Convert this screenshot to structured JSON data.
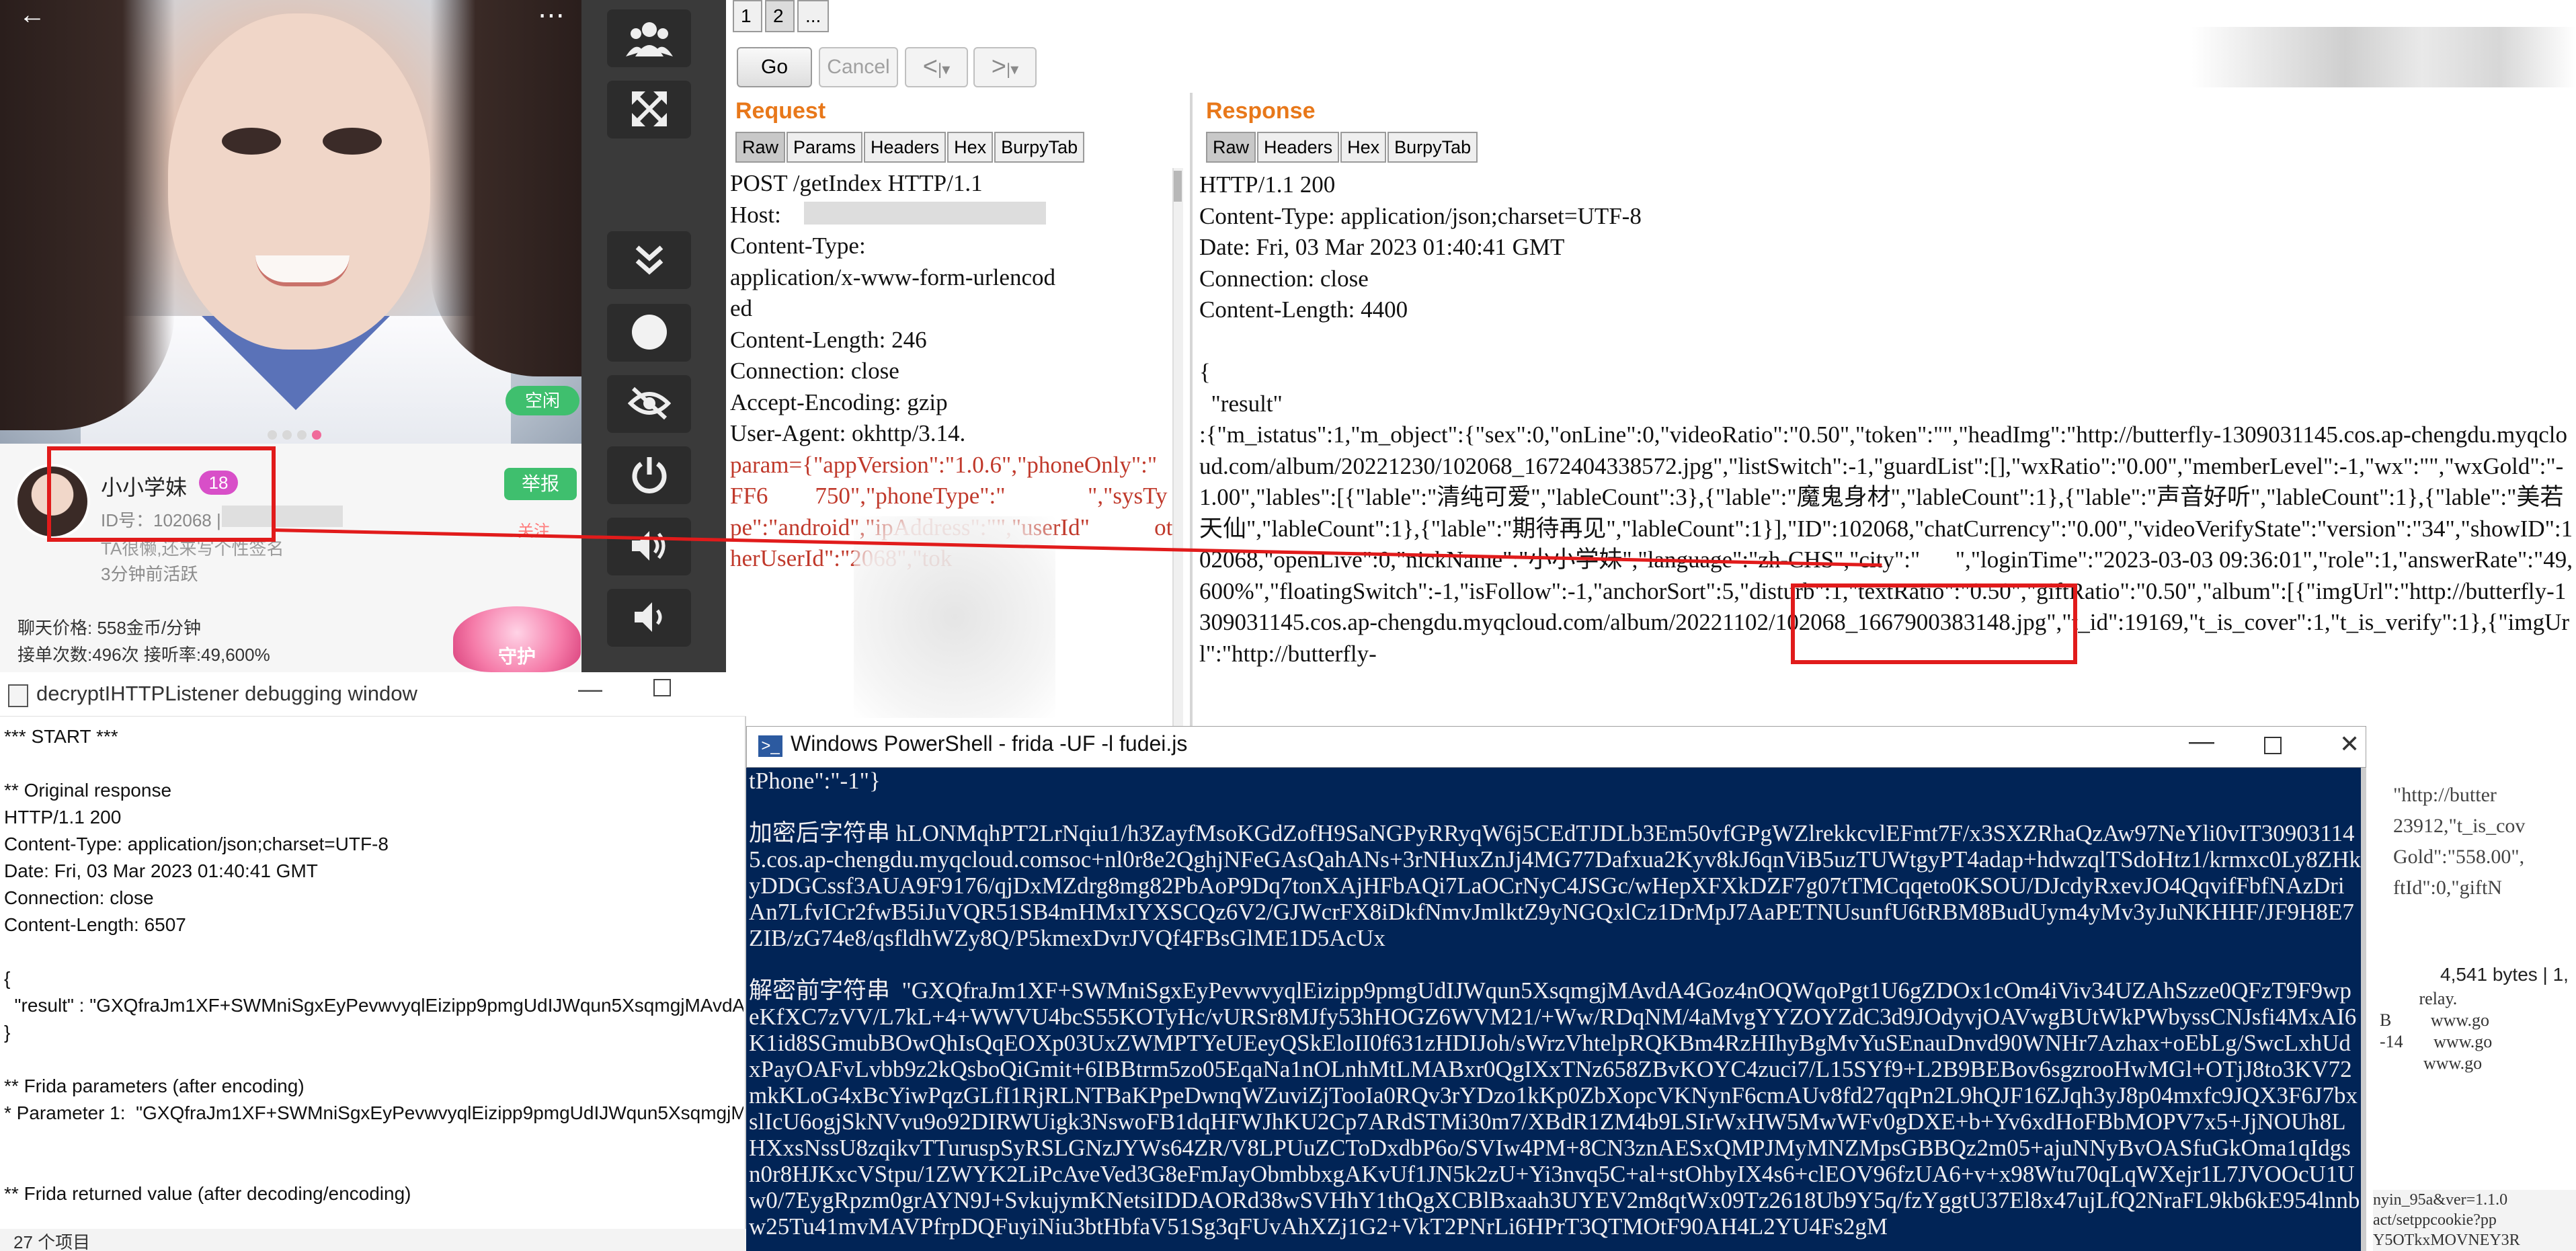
{
  "app_phone": {
    "idle_badge": "空闲",
    "nickname": "小小学妹",
    "age": "18",
    "report_btn": "举报",
    "follow_btn": "关注",
    "id_label": "ID号：102068 |",
    "intro": "TA很懒,还来写个性签名",
    "online_time": "3分钟前活跃",
    "price": "聊天价格: 558金币/分钟",
    "stats": "接单次数:496次 接听率:49,600%",
    "guard": "守护",
    "carousel": {
      "count": 4,
      "active": 4
    }
  },
  "controls": {
    "icons": [
      "group-icon",
      "fullscreen-icon",
      "chevron-down-double-icon",
      "record-icon",
      "eye-hidden-icon",
      "power-icon",
      "volume-up-icon",
      "volume-down-icon"
    ]
  },
  "burp": {
    "tabs": [
      "1",
      "2",
      "..."
    ],
    "go": "Go",
    "cancel": "Cancel",
    "request_title": "Request",
    "response_title": "Response",
    "req_tabs": [
      "Raw",
      "Params",
      "Headers",
      "Hex",
      "BurpyTab"
    ],
    "resp_tabs": [
      "Raw",
      "Headers",
      "Hex",
      "BurpyTab"
    ],
    "request_lines": [
      "POST /getIndex HTTP/1.1",
      "Host:",
      "Content-Type:",
      "application/x-www-form-urlencod",
      "ed",
      "Content-Length: 246",
      "Connection: close",
      "Accept-Encoding: gzip",
      "User-Agent: okhttp/3.14.",
      ""
    ],
    "request_param_prefix": "param=",
    "request_param_text": "{\"appVersion\":\"1.0.6\",\"phoneOnly\":\"                  FF6        750\",\"phoneType\":\"              \",\"sysType\":\"android\",\"ipAddress\":\"\",\"userId\"           otherUserId\":\"2068\",\"tok",
    "response_text": "HTTP/1.1 200\nContent-Type: application/json;charset=UTF-8\nDate: Fri, 03 Mar 2023 01:40:41 GMT\nConnection: close\nContent-Length: 4400\n\n{\n  \"result\"\n:{\"m_istatus\":1,\"m_object\":{\"sex\":0,\"onLine\":0,\"videoRatio\":\"0.50\",\"token\":\"\",\"headImg\":\"http://butterfly-1309031145.cos.ap-chengdu.myqcloud.com/album/20221230/102068_1672404338572.jpg\",\"listSwitch\":-1,\"guardList\":[],\"wxRatio\":\"0.00\",\"memberLevel\":-1,\"wx\":\"\",\"wxGold\":\"-1.00\",\"lables\":[{\"lable\":\"清纯可爱\",\"lableCount\":3},{\"lable\":\"魔鬼身材\",\"lableCount\":1},{\"lable\":\"声音好听\",\"lableCount\":1},{\"lable\":\"美若天仙\",\"lableCount\":1},{\"lable\":\"期待再见\",\"lableCount\":1}],\"ID\":102068,\"chatCurrency\":\"0.00\",\"videoVerifyState\":\"version\":\"34\",\"showID\":102068,\"openLive\":0,\"nickName\":\"小小学妹\",\"language\":\"zh-CHS\",\"city\":\"      \",\"loginTime\":\"2023-03-03 09:36:01\",\"role\":1,\"answerRate\":\"49,600%\",\"floatingSwitch\":-1,\"isFollow\":-1,\"anchorSort\":5,\"disturb\":1,\"textRatio\":\"0.50\",\"giftRatio\":\"0.50\",\"album\":[{\"imgUrl\":\"http://butterfly-1309031145.cos.ap-chengdu.myqcloud.com/album/20221102/102068_1667900383148.jpg\",\"t_id\":19169,\"t_is_cover\":1,\"t_is_verify\":1},{\"imgUrl\":\"http://butterfly-"
  },
  "debug_window": {
    "title": "decryptIHTTPListener debugging window",
    "lines": [
      "*** START ***",
      "",
      "** Original response",
      "HTTP/1.1 200",
      "Content-Type: application/json;charset=UTF-8",
      "Date: Fri, 03 Mar 2023 01:40:41 GMT",
      "Connection: close",
      "Content-Length: 6507",
      "",
      "{",
      "  \"result\" : \"GXQfraJm1XF+SWMniSgxEyPevwvyqlEizipp9pmgUdIJWqun5XsqmgjMAvdA",
      "}",
      "",
      "** Frida parameters (after encoding)",
      "* Parameter 1:  \"GXQfraJm1XF+SWMniSgxEyPevwvyqlEizipp9pmgUdIJWqun5XsqmgjMAvdA",
      "",
      "",
      "** Frida returned value (after decoding/encoding)"
    ],
    "status": "27 个项目"
  },
  "powershell": {
    "title": "Windows PowerShell - frida  -UF -l fudei.js",
    "text": "tPhone\":\"-1\"}\n\n加密后字符串 hLONMqhPT2LrNqiu1/h3ZayfMsoKGdZofH9SaNGPyRRyqW6j5CEdTJDLb3Em50vfGPgWZlrekkcvlEFmt7F/x3SXZRhaQzAw97NeYli0vIT309031145.cos.ap-chengdu.myqcloud.comsoc+nl0r8e2QghjNFeGAsQahANs+3rNHuxZnJj4MG77Dafxua2Kyv8kJ6qnViB5uzTUWtgyPT4adap+hdwzqlTSdoHtz1/krmxc0Ly8ZHkyDDGCssf3AUA9F9176/qjDxMZdrg8mg82PbAoP9Dq7tonXAjHFbAQi7LaOCrNyC4JSGc/wHepXFXkDZF7g07tTMCqqeto0KSOU/DJcdyRxevJO4QqvifFbfNAzDriAn7LfvICr2fwB5iJuVQR51SB4mHMxIYXSCQz6V2/GJWcrFX8iDkfNmvJmlktZ9yNGQxlCz1DrMpJ7AaPETNUsunfU6tRBM8BudUym4yMv3yJuNKHHF/JF9H8E7ZIB/zG74e8/qsfldhWZy8Q/P5kmexDvrJVQf4FBsGlME1D5AcUx\n\n解密前字符串  \"GXQfraJm1XF+SWMniSgxEyPevwvyqlEizipp9pmgUdIJWqun5XsqmgjMAvdA4Goz4nOQWqoPgt1U6gZDOx1cOm4iViv34UZAhSzze0QFzT9F9wpeKfXC7zVV/L7kL+4+WWVU4bcS55KOTyHc/vURSr8MJfy53hHOGZ6WVM21/+Ww/RDqNM/4aMvgYYZOYZdC3d9JOdyvjOAVwgBUtWkPWbyssCNJsfi4MxAI6K1id8SGmubBOwQhIsQqEOXp03UxZWMPTYeUEeyQSkEloII0f631zHDIJoh/sWrzVhtelpRQKBm4RzHIhyBgMvYuSEnauDnvd90WNHr7Azhax+oEbLg/SwcLxhUdxPayOAFvLvbb9z2kQsboQiGmit+6IBBtrm5zo05EqaNa1nOLnhMtLMABxr0QgIXxTNz658ZBvKOYC4zuci7/L15SYf9+L2B9BEBov6sgzrooHwMGl+OTjJ8to3KV72mkKLoG4xBcYiwPqzGLfI1RjRLNTBaKPpeDwnqWZuviZjTooIa0RQv3rYDzo1kKp0ZbXopcVKNynF6cmAUv8fd27qqPn2L9hQJF16ZJqh3yJ8p04mxfc9JQX3F6J7bxslIcU6ogjSkNVvu9o92DIRWUigk3NswoFB1dqHFWJhKU2Cp7ARdSTMi30m7/XBdR1ZM4b9LSIrWxHW5MwWFv0gDXE+b+Yv6xdHoFBbMOPV7x5+JjNOUh8LHXxsNssU8zqikvTTuruspSyRSLGNzJYWs64ZR/V8LPUuZCToDxdbP6o/SVIw4PM+8CN3znAESxQMPJMyMNZMpsGBBQz2m05+ajuNNyBvOASfuGkOma1qIdgsn0r8HJKxcVStpu/1ZWYK2LiPcAveVed3G8eFmJayObmbbxgAKvUf1JN5k2zU+Yi3nvq5C+al+stOhbyIX4s6+clEOV96fzUA6+v+x98Wtu70qLqWXejr1L7JVOOcU1Uw0/7EygRpzm0grAYN9J+SvkujymKNetsiIDDAORd38wSVHhY1thQgXCBlBxaah3UYEV2m8qtWx09Tz2618Ub9Y5q/fzYggtU37El8x47ujLfQ2NraFL9kb6kE954lnnbw25Tu41mvMAVPfrpDQFuyiNiu3btHbfaV51Sg3qFUvAhXZj1G2+VkT2PNrLi6HPrT3QTMOtF90AH4L2YU4Fs2gM"
  },
  "side_panel": {
    "text_lines": [
      "\"http://butter",
      "23912,\"t_is_cov",
      "Gold\":\"558.00\",",
      "ftId\":0,\"giftN"
    ],
    "bytes": "4,541 bytes | 1,",
    "grid_lines": [
      "         relay.",
      "B         www.go",
      "-14       www.go",
      "          www.go"
    ],
    "bottom_lines": [
      "nyin_95a&ver=1.1.0",
      "act/setppcookie?pp",
      "Y5OTkxMOVNEY3R"
    ]
  }
}
